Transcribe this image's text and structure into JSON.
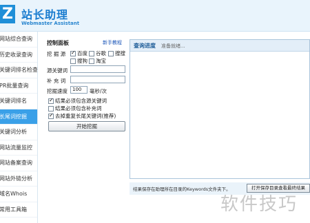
{
  "header": {
    "logo_letter": "Z",
    "title": "站长助理",
    "subtitle": "Webmaster Assistant"
  },
  "sidebar": {
    "items": [
      {
        "label": "网站综合查询"
      },
      {
        "label": "历史收录查询"
      },
      {
        "label": "关键词排名检查"
      },
      {
        "label": "PR批量查询"
      },
      {
        "label": "关键词排名"
      },
      {
        "label": "长尾词挖掘"
      },
      {
        "label": "关键词分析"
      },
      {
        "label": "网站流量监控"
      },
      {
        "label": "网站备案查询"
      },
      {
        "label": "网站外链分析"
      },
      {
        "label": "域名Whois"
      },
      {
        "label": "常用工具箱"
      }
    ],
    "active_index": 5
  },
  "panel": {
    "title": "控制面板",
    "help_link": "新手教程",
    "source_label": "挖 掘 源",
    "sources": [
      {
        "label": "百度",
        "checked": true
      },
      {
        "label": "谷歌",
        "checked": false
      },
      {
        "label": "搜搜",
        "checked": false
      },
      {
        "label": "搜狗",
        "checked": false
      },
      {
        "label": "淘宝",
        "checked": false
      }
    ],
    "source_keyword_label": "源关键词",
    "source_keyword_value": "",
    "supplement_label": "补 充 词",
    "supplement_value": "",
    "speed_label": "挖掘速度",
    "speed_value": "100",
    "speed_unit": "毫秒/次",
    "options": [
      {
        "label": "结果必须包含源关键词",
        "checked": true
      },
      {
        "label": "结果必须包含补充词",
        "checked": false
      },
      {
        "label": "去掉重复长尾关键词(推荐)",
        "checked": true
      }
    ],
    "start_button": "开始挖掘"
  },
  "progress": {
    "label": "查询进度",
    "status": "准备就绪..."
  },
  "bottom": {
    "note": "结果保存在助理所在目录的Keywords文件夹下。",
    "open_button": "打开保存目录查看最终结果"
  },
  "watermark": {
    "text": "软件技巧"
  },
  "colors": {
    "accent": "#3aa0e8",
    "brand": "#1f8fd8",
    "header_bg": "#e9f4fc"
  }
}
